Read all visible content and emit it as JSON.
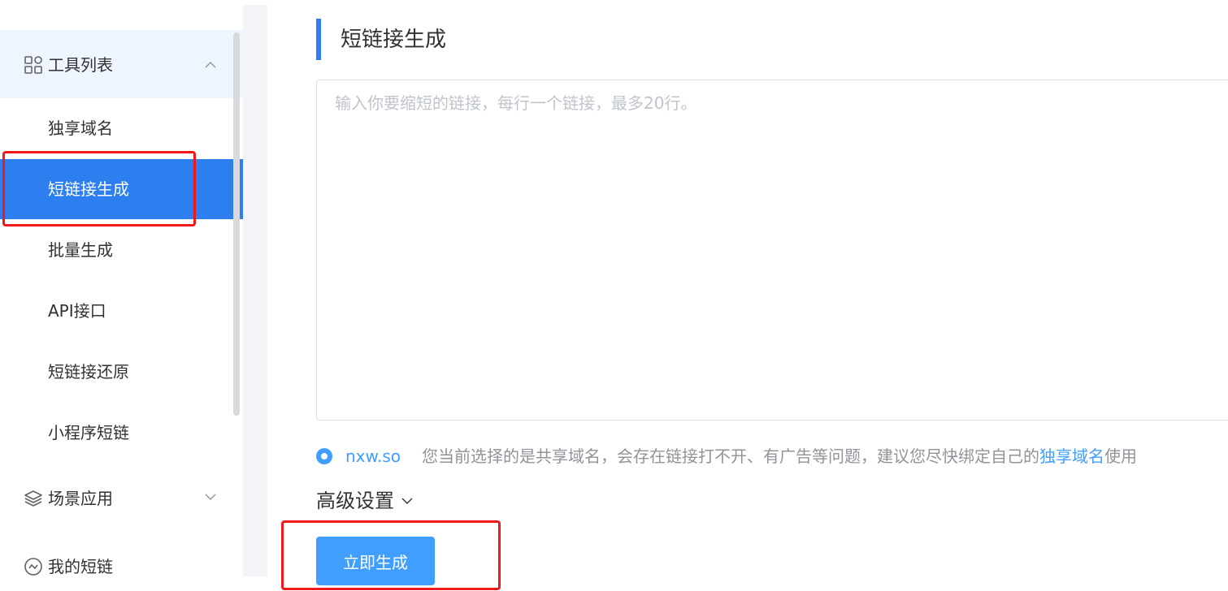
{
  "sidebar": {
    "group_tools": {
      "label": "工具列表",
      "icon": "grid-apps-icon",
      "expanded": true
    },
    "items": [
      {
        "label": "独享域名",
        "active": false
      },
      {
        "label": "短链接生成",
        "active": true
      },
      {
        "label": "批量生成",
        "active": false
      },
      {
        "label": "API接口",
        "active": false
      },
      {
        "label": "短链接还原",
        "active": false
      },
      {
        "label": "小程序短链",
        "active": false
      }
    ],
    "group_scenes": {
      "label": "场景应用",
      "icon": "layers-icon",
      "expanded": false
    },
    "group_mine": {
      "label": "我的短链",
      "icon": "link-badge-icon"
    }
  },
  "main": {
    "title": "短链接生成",
    "textarea_placeholder": "输入你要缩短的链接，每行一个链接，最多20行。",
    "domain_option": "nxw.so",
    "notice_prefix": "您当前选择的是共享域名，会存在链接打不开、有广告等问题，建议您尽快绑定自己的",
    "notice_link": "独享域名",
    "notice_suffix": "使用",
    "advanced_label": "高级设置",
    "submit_label": "立即生成"
  },
  "colors": {
    "accent": "#2d7ff0",
    "primary_button": "#409eff",
    "highlight_box": "#f01818",
    "group_bg": "#eef5fe"
  }
}
